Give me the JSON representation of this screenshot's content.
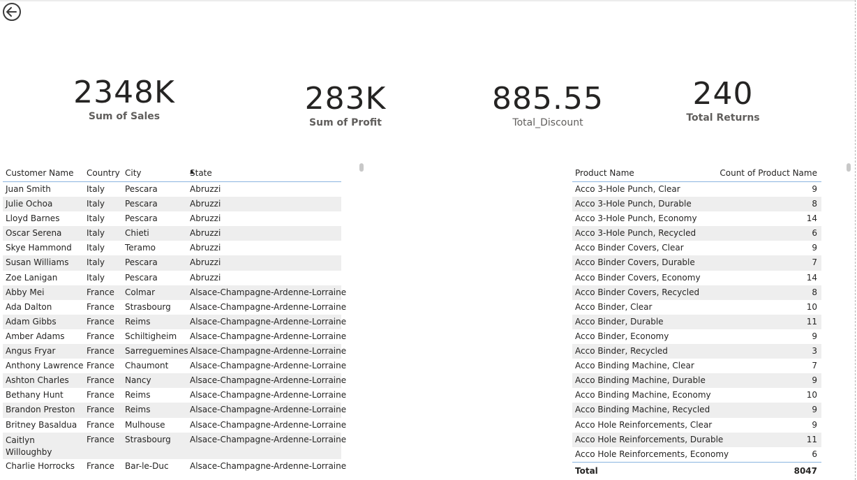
{
  "nav": {
    "back_icon": "back-arrow-circle-icon"
  },
  "cards": [
    {
      "value": "2348K",
      "label": "Sum of Sales"
    },
    {
      "value": "283K",
      "label": "Sum of Profit"
    },
    {
      "value": "885.55",
      "label": "Total_Discount"
    },
    {
      "value": "240",
      "label": "Total Returns"
    }
  ],
  "customers": {
    "headers": [
      "Customer Name",
      "Country",
      "City",
      "State"
    ],
    "sort_column": "State",
    "rows": [
      [
        "Juan Smith",
        "Italy",
        "Pescara",
        "Abruzzi"
      ],
      [
        "Julie Ochoa",
        "Italy",
        "Pescara",
        "Abruzzi"
      ],
      [
        "Lloyd Barnes",
        "Italy",
        "Pescara",
        "Abruzzi"
      ],
      [
        "Oscar Serena",
        "Italy",
        "Chieti",
        "Abruzzi"
      ],
      [
        "Skye Hammond",
        "Italy",
        "Teramo",
        "Abruzzi"
      ],
      [
        "Susan Williams",
        "Italy",
        "Pescara",
        "Abruzzi"
      ],
      [
        "Zoe Lanigan",
        "Italy",
        "Pescara",
        "Abruzzi"
      ],
      [
        "Abby Mei",
        "France",
        "Colmar",
        "Alsace-Champagne-Ardenne-Lorraine"
      ],
      [
        "Ada Dalton",
        "France",
        "Strasbourg",
        "Alsace-Champagne-Ardenne-Lorraine"
      ],
      [
        "Adam Gibbs",
        "France",
        "Reims",
        "Alsace-Champagne-Ardenne-Lorraine"
      ],
      [
        "Amber Adams",
        "France",
        "Schiltigheim",
        "Alsace-Champagne-Ardenne-Lorraine"
      ],
      [
        "Angus Fryar",
        "France",
        "Sarreguemines",
        "Alsace-Champagne-Ardenne-Lorraine"
      ],
      [
        "Anthony Lawrence",
        "France",
        "Chaumont",
        "Alsace-Champagne-Ardenne-Lorraine"
      ],
      [
        "Ashton Charles",
        "France",
        "Nancy",
        "Alsace-Champagne-Ardenne-Lorraine"
      ],
      [
        "Bethany Hunt",
        "France",
        "Reims",
        "Alsace-Champagne-Ardenne-Lorraine"
      ],
      [
        "Brandon Preston",
        "France",
        "Reims",
        "Alsace-Champagne-Ardenne-Lorraine"
      ],
      [
        "Britney Basaldua",
        "France",
        "Mulhouse",
        "Alsace-Champagne-Ardenne-Lorraine"
      ],
      [
        "Caitlyn Willoughby",
        "France",
        "Strasbourg",
        "Alsace-Champagne-Ardenne-Lorraine"
      ],
      [
        "Charlie Horrocks",
        "France",
        "Bar-le-Duc",
        "Alsace-Champagne-Ardenne-Lorraine"
      ]
    ]
  },
  "products": {
    "headers": [
      "Product Name",
      "Count of Product Name"
    ],
    "rows": [
      [
        "Acco 3-Hole Punch, Clear",
        "9"
      ],
      [
        "Acco 3-Hole Punch, Durable",
        "8"
      ],
      [
        "Acco 3-Hole Punch, Economy",
        "14"
      ],
      [
        "Acco 3-Hole Punch, Recycled",
        "6"
      ],
      [
        "Acco Binder Covers, Clear",
        "9"
      ],
      [
        "Acco Binder Covers, Durable",
        "7"
      ],
      [
        "Acco Binder Covers, Economy",
        "14"
      ],
      [
        "Acco Binder Covers, Recycled",
        "8"
      ],
      [
        "Acco Binder, Clear",
        "10"
      ],
      [
        "Acco Binder, Durable",
        "11"
      ],
      [
        "Acco Binder, Economy",
        "9"
      ],
      [
        "Acco Binder, Recycled",
        "3"
      ],
      [
        "Acco Binding Machine, Clear",
        "7"
      ],
      [
        "Acco Binding Machine, Durable",
        "9"
      ],
      [
        "Acco Binding Machine, Economy",
        "10"
      ],
      [
        "Acco Binding Machine, Recycled",
        "9"
      ],
      [
        "Acco Hole Reinforcements, Clear",
        "9"
      ],
      [
        "Acco Hole Reinforcements, Durable",
        "11"
      ],
      [
        "Acco Hole Reinforcements, Economy",
        "6"
      ]
    ],
    "total_label": "Total",
    "total_value": "8047"
  }
}
